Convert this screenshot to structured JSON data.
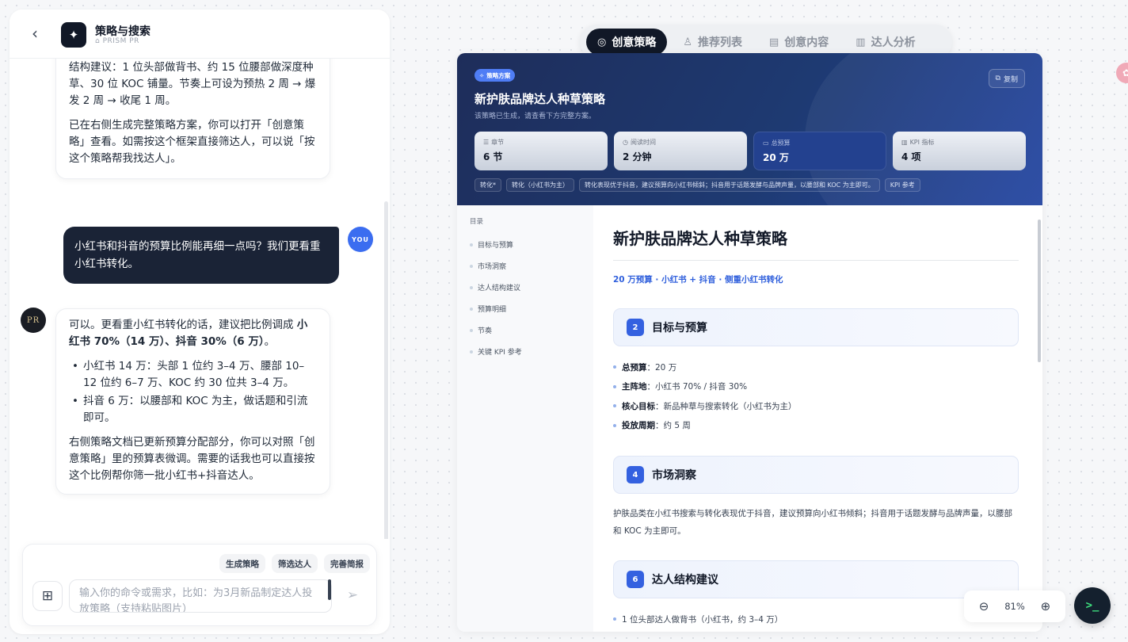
{
  "chat": {
    "back_icon": "chevron-left-icon",
    "app_title": "策略与搜索",
    "app_subtitle": "PRISM PR",
    "messages": {
      "ai_1": {
        "p1": "结构建议：1 位头部做背书、约 15 位腰部做深度种草、30 位 KOC 铺量。节奏上可设为预热 2 周 → 爆发 2 周 → 收尾 1 周。",
        "p2": "已在右侧生成完整策略方案，你可以打开「创意策略」查看。如需按这个框架直接筛达人，可以说「按这个策略帮我找达人」。"
      },
      "user": {
        "text": "小红书和抖音的预算比例能再细一点吗？我们更看重小红书转化。",
        "avatar": "YOU"
      },
      "ai_2": {
        "avatar": "PR",
        "lead": "可以。更看重小红书转化的话，建议把比例调成 ",
        "lead_bold": "小红书 70%（14 万）、抖音 30%（6 万）",
        "lead_end": "。",
        "bullets": [
          "小红书 14 万：头部 1 位约 3–4 万、腰部 10–12 位约 6–7 万、KOC 约 30 位共 3–4 万。",
          "抖音 6 万：以腰部和 KOC 为主，做话题和引流即可。"
        ],
        "closing": "右侧策略文档已更新预算分配部分，你可以对照「创意策略」里的预算表微调。需要的话我也可以直接按这个比例帮你筛一批小红书+抖音达人。"
      }
    },
    "composer": {
      "chips": [
        "生成策略",
        "筛选达人",
        "完善简报"
      ],
      "placeholder": "输入你的命令或需求，比如：为3月新品制定达人投放策略（支持粘贴图片）"
    }
  },
  "tabs": [
    {
      "label": "创意策略",
      "icon": "target-icon",
      "active": true
    },
    {
      "label": "推荐列表",
      "icon": "users-icon",
      "active": false
    },
    {
      "label": "创意内容",
      "icon": "document-icon",
      "active": false
    },
    {
      "label": "达人分析",
      "icon": "bar-chart-icon",
      "active": false
    }
  ],
  "doc": {
    "badge": "策略方案",
    "copy_label": "复制",
    "title": "新护肤品牌达人种草策略",
    "subtitle": "该策略已生成，请查看下方完整方案。",
    "stats": [
      {
        "label": "章节",
        "value": "6 节"
      },
      {
        "label": "阅读时间",
        "value": "2 分钟"
      },
      {
        "label": "总预算",
        "value": "20 万"
      },
      {
        "label": "KPI 指标",
        "value": "4 项"
      }
    ],
    "tags": [
      "转化*",
      "转化（小红书为主）",
      "转化表现优于抖音，建议预算向小红书倾斜；抖音用于话题发酵与品牌声量，以腰部和 KOC 为主即可。",
      "KPI 参考"
    ],
    "toc_title": "目录",
    "toc": [
      "目标与预算",
      "市场洞察",
      "达人结构建议",
      "预算明细",
      "节奏",
      "关键 KPI 参考"
    ],
    "content": {
      "title": "新护肤品牌达人种草策略",
      "subtitle": "20 万预算 · 小红书 + 抖音 · 侧重小红书转化",
      "sections": [
        {
          "num": "2",
          "name": "目标与预算",
          "items": [
            {
              "k": "总预算",
              "v": "：20 万"
            },
            {
              "k": "主阵地",
              "v": "：小红书 70% / 抖音 30%"
            },
            {
              "k": "核心目标",
              "v": "：新品种草与搜索转化（小红书为主）"
            },
            {
              "k": "投放周期",
              "v": "：约 5 周"
            }
          ]
        },
        {
          "num": "4",
          "name": "市场洞察",
          "text": "护肤品类在小红书搜索与转化表现优于抖音，建议预算向小红书倾斜；抖音用于话题发酵与品牌声量，以腰部和 KOC 为主即可。"
        },
        {
          "num": "6",
          "name": "达人结构建议",
          "items_text": [
            "1 位头部达人做背书（小红书，约 3–4 万）"
          ]
        }
      ]
    }
  },
  "zoom": {
    "value": "81%"
  },
  "terminal_icon": "terminal-icon"
}
